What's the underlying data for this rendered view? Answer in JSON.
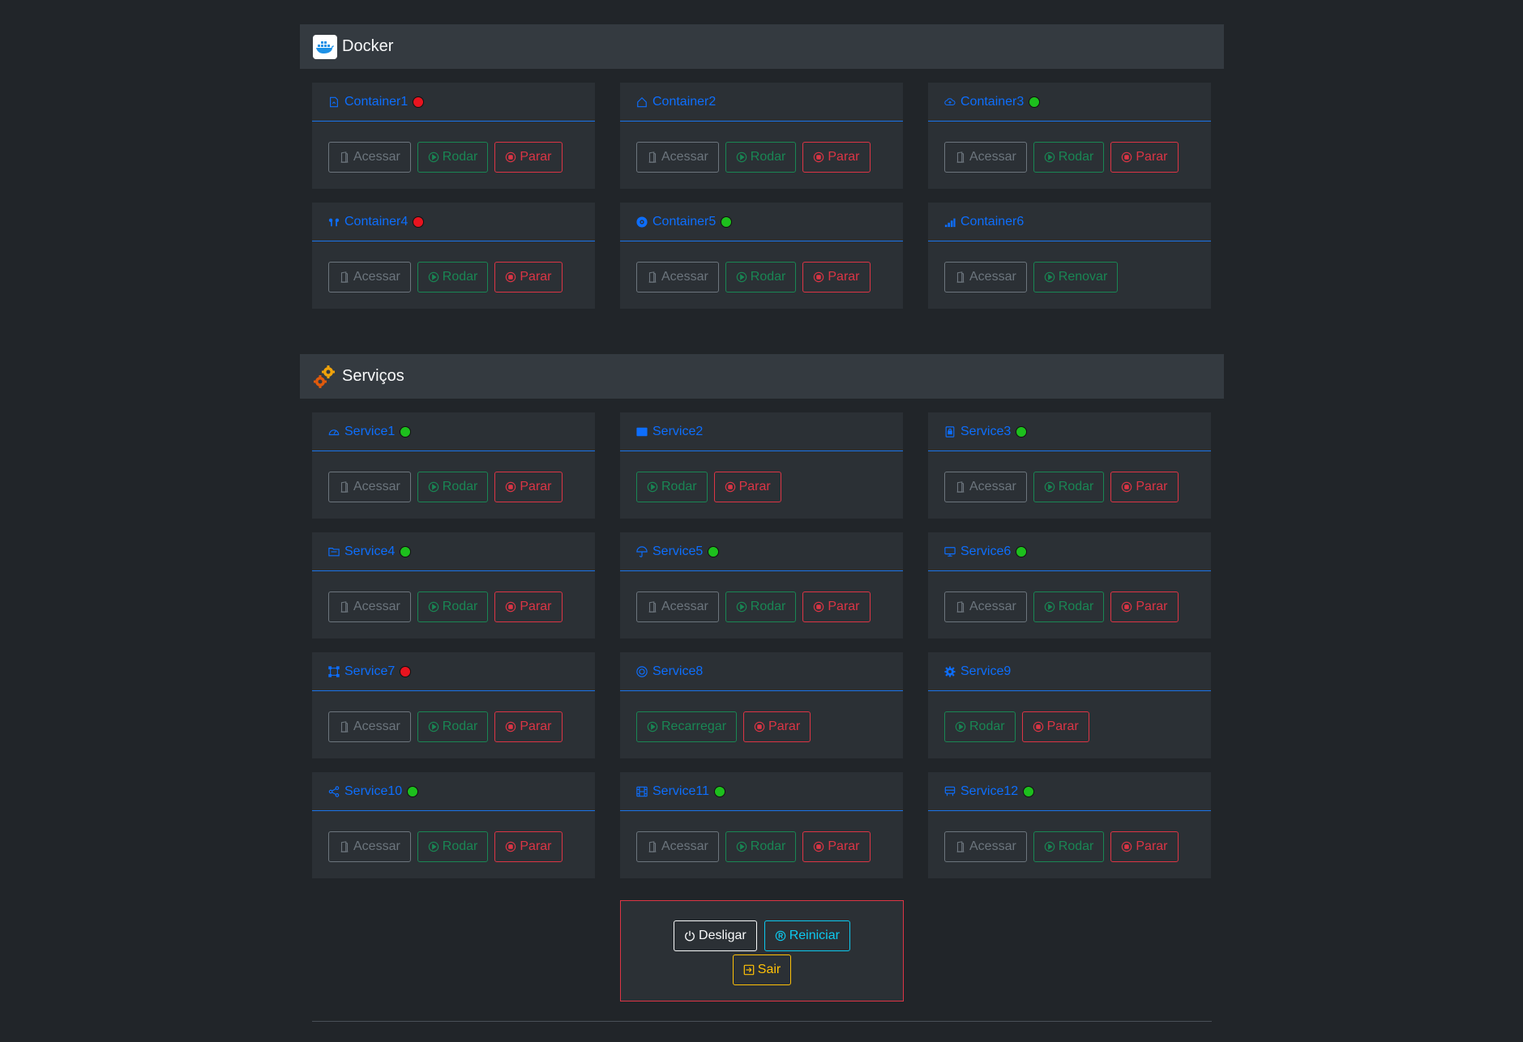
{
  "docker": {
    "title": "Docker",
    "containers": [
      {
        "name": "Container1",
        "icon": "file-icon",
        "status": "red",
        "status_color": "#e8141f",
        "buttons": [
          "Acessar",
          "Rodar",
          "Parar"
        ]
      },
      {
        "name": "Container2",
        "icon": "house-icon",
        "status": "none",
        "buttons": [
          "Acessar",
          "Rodar",
          "Parar"
        ]
      },
      {
        "name": "Container3",
        "icon": "cloud-icon",
        "status": "green",
        "status_color": "#1dbf1d",
        "buttons": [
          "Acessar",
          "Rodar",
          "Parar"
        ]
      },
      {
        "name": "Container4",
        "icon": "earbuds-icon",
        "status": "red",
        "status_color": "#e8141f",
        "buttons": [
          "Acessar",
          "Rodar",
          "Parar"
        ]
      },
      {
        "name": "Container5",
        "icon": "disc-icon",
        "status": "green",
        "status_color": "#1dbf1d",
        "buttons": [
          "Acessar",
          "Rodar",
          "Parar"
        ]
      },
      {
        "name": "Container6",
        "icon": "bar-chart-icon",
        "status": "none",
        "buttons": [
          "Acessar",
          "Renovar"
        ]
      }
    ]
  },
  "services": {
    "title": "Serviços",
    "items": [
      {
        "name": "Service1",
        "icon": "speedometer-icon",
        "status": "green",
        "status_color": "#1dbf1d",
        "buttons": [
          "Acessar",
          "Rodar",
          "Parar"
        ]
      },
      {
        "name": "Service2",
        "icon": "window-icon",
        "status": "none",
        "buttons": [
          "Rodar",
          "Parar"
        ]
      },
      {
        "name": "Service3",
        "icon": "file-lock-icon",
        "status": "green",
        "status_color": "#1dbf1d",
        "buttons": [
          "Acessar",
          "Rodar",
          "Parar"
        ]
      },
      {
        "name": "Service4",
        "icon": "folder-icon",
        "status": "green",
        "status_color": "#1dbf1d",
        "buttons": [
          "Acessar",
          "Rodar",
          "Parar"
        ]
      },
      {
        "name": "Service5",
        "icon": "umbrella-icon",
        "status": "green",
        "status_color": "#1dbf1d",
        "buttons": [
          "Acessar",
          "Rodar",
          "Parar"
        ]
      },
      {
        "name": "Service6",
        "icon": "display-icon",
        "status": "green",
        "status_color": "#1dbf1d",
        "buttons": [
          "Acessar",
          "Rodar",
          "Parar"
        ]
      },
      {
        "name": "Service7",
        "icon": "bounding-box-icon",
        "status": "red",
        "status_color": "#e8141f",
        "buttons": [
          "Acessar",
          "Rodar",
          "Parar"
        ]
      },
      {
        "name": "Service8",
        "icon": "target-icon",
        "status": "none",
        "buttons": [
          "Recarregar",
          "Parar"
        ]
      },
      {
        "name": "Service9",
        "icon": "gear-icon",
        "status": "none",
        "buttons": [
          "Rodar",
          "Parar"
        ]
      },
      {
        "name": "Service10",
        "icon": "share-icon",
        "status": "green",
        "status_color": "#1dbf1d",
        "buttons": [
          "Acessar",
          "Rodar",
          "Parar"
        ]
      },
      {
        "name": "Service11",
        "icon": "film-icon",
        "status": "green",
        "status_color": "#1dbf1d",
        "buttons": [
          "Acessar",
          "Rodar",
          "Parar"
        ]
      },
      {
        "name": "Service12",
        "icon": "bus-icon",
        "status": "green",
        "status_color": "#1dbf1d",
        "buttons": [
          "Acessar",
          "Rodar",
          "Parar"
        ]
      }
    ]
  },
  "power": {
    "shutdown_label": "Desligar",
    "restart_label": "Reiniciar",
    "exit_label": "Sair"
  },
  "colors": {
    "background": "#212529",
    "card": "#2b3035",
    "accent": "#0d6efd",
    "success": "#198754",
    "danger": "#dc3545",
    "secondary": "#6c757d",
    "info": "#0dcaf0",
    "warning": "#ffc107"
  }
}
